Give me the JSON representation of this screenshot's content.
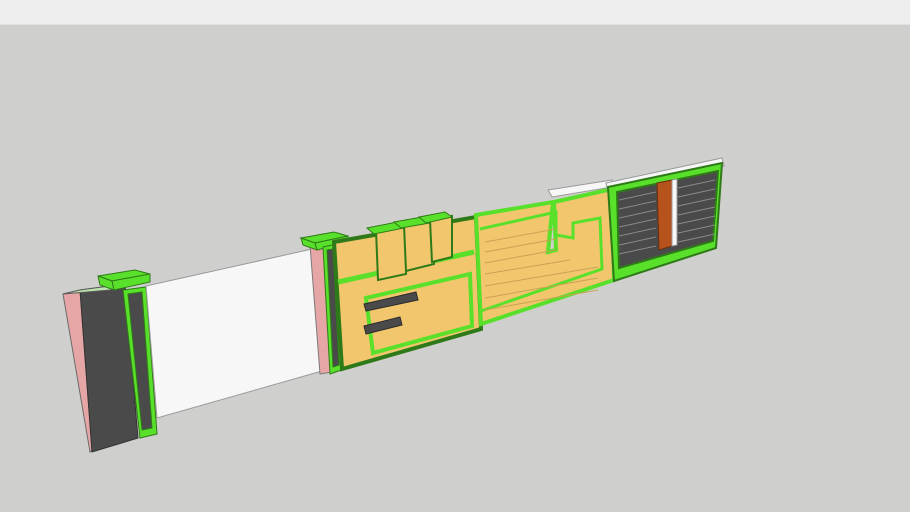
{
  "app": {
    "background_color": "#cfcfcd",
    "topbar_color": "#eeeeef"
  },
  "model": {
    "description_visible": false,
    "colors": {
      "highlight_green": "#59e02a",
      "panel_yellow": "#f1c66d",
      "dark_gray": "#4a4a4a",
      "pink_side": "#e5a6a5",
      "wall_white": "#f7f7f7",
      "wood_brown": "#b6521b",
      "light_top": "#bfe8b0"
    },
    "parts": [
      "left-pillar",
      "white-wall",
      "middle-pillar",
      "gate-left-panel",
      "gate-sliding-panel",
      "right-vent-panel"
    ]
  }
}
